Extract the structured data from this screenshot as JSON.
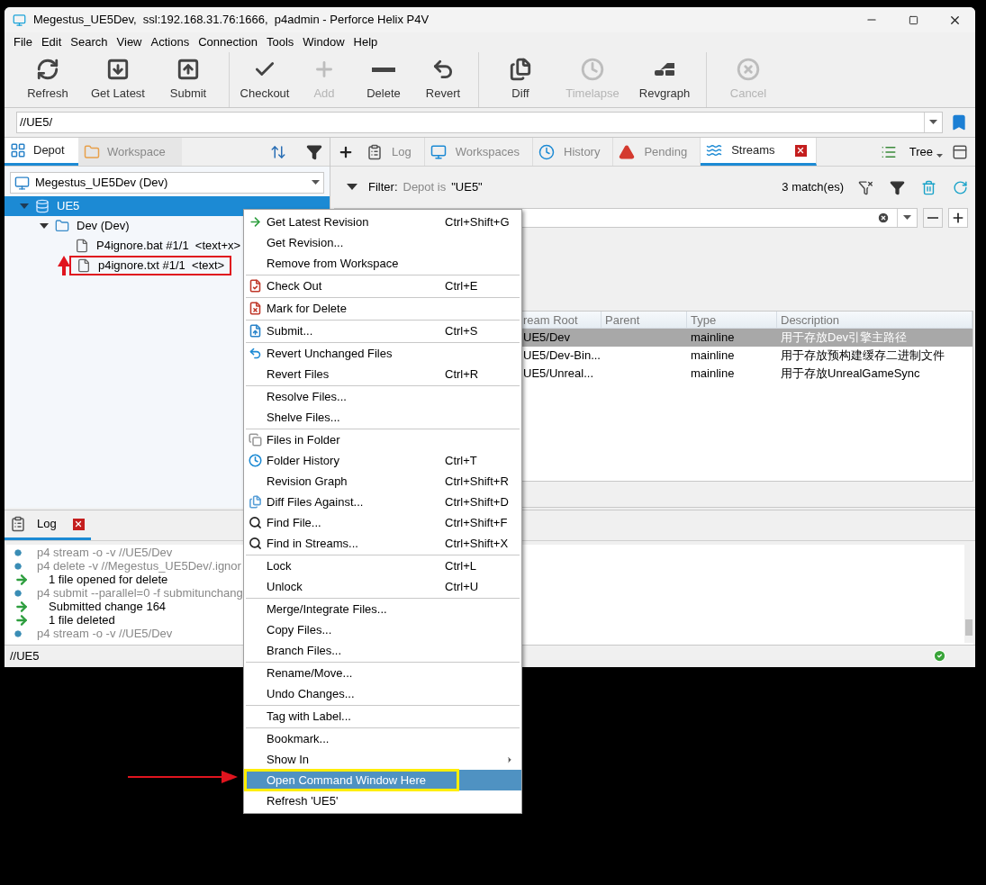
{
  "window": {
    "title": "Megestus_UE5Dev,  ssl:192.168.31.76:1666,  p4admin - Perforce Helix P4V"
  },
  "menubar": [
    {
      "label": "File"
    },
    {
      "label": "Edit"
    },
    {
      "label": "Search"
    },
    {
      "label": "View"
    },
    {
      "label": "Actions"
    },
    {
      "label": "Connection"
    },
    {
      "label": "Tools"
    },
    {
      "label": "Window"
    },
    {
      "label": "Help"
    }
  ],
  "toolbar": [
    [
      {
        "label": "Refresh",
        "disabled": false
      },
      {
        "label": "Get Latest",
        "disabled": false
      },
      {
        "label": "Submit",
        "disabled": false
      }
    ],
    [
      {
        "label": "Checkout",
        "disabled": false
      },
      {
        "label": "Add",
        "disabled": true
      },
      {
        "label": "Delete",
        "disabled": false
      },
      {
        "label": "Revert",
        "disabled": false
      }
    ],
    [
      {
        "label": "Diff",
        "disabled": false
      },
      {
        "label": "Timelapse",
        "disabled": true
      },
      {
        "label": "Revgraph",
        "disabled": false
      }
    ],
    [
      {
        "label": "Cancel",
        "disabled": true
      }
    ]
  ],
  "path_field": {
    "value": "//UE5/"
  },
  "left_panel": {
    "tabs": [
      {
        "label": "Depot",
        "selected": true
      },
      {
        "label": "Workspace",
        "selected": false
      }
    ],
    "workspace_select": {
      "value": "Megestus_UE5Dev (Dev)"
    },
    "tree": [
      {
        "label": "UE5",
        "selected": true,
        "expanded": true,
        "marked": false,
        "children": [
          {
            "label": "Dev (Dev)",
            "selected": false,
            "expanded": true,
            "marked": false,
            "children": [
              {
                "label": "P4ignore.bat #1/1  <text+x>",
                "selected": false,
                "marked": false
              },
              {
                "label": "p4ignore.txt #1/1  <text>",
                "selected": false,
                "marked": true
              }
            ]
          }
        ]
      }
    ]
  },
  "right_panel": {
    "tabs": [
      {
        "label": "Log",
        "selected": false,
        "closable": false
      },
      {
        "label": "Workspaces",
        "selected": false,
        "closable": false
      },
      {
        "label": "History",
        "selected": false,
        "closable": false
      },
      {
        "label": "Pending",
        "selected": false,
        "closable": false
      },
      {
        "label": "Streams",
        "selected": true,
        "closable": true
      }
    ],
    "view_mode": "Tree",
    "filter": {
      "label": "Filter:",
      "field": "Depot is",
      "value": "\"UE5\"",
      "matches": "3 match(es)"
    },
    "table": {
      "columns": [
        "ream Root",
        "Parent",
        "Type",
        "Description"
      ],
      "rows": [
        {
          "cells": [
            "UE5/Dev",
            "",
            "mainline",
            "用于存放Dev引擎主路径"
          ],
          "selected": true
        },
        {
          "cells": [
            "UE5/Dev-Bin...",
            "",
            "mainline",
            "用于存放预构建缓存二进制文件"
          ],
          "selected": false
        },
        {
          "cells": [
            "UE5/Unreal...",
            "",
            "mainline",
            "用于存放UnrealGameSync"
          ],
          "selected": false
        }
      ]
    }
  },
  "log_panel": {
    "tab": "Log",
    "lines": [
      {
        "kind": "command",
        "text": "p4 stream -o -v //UE5/Dev"
      },
      {
        "kind": "command",
        "text": "p4 delete -v //Megestus_UE5Dev/.ignor"
      },
      {
        "kind": "result",
        "text": "1 file opened for delete"
      },
      {
        "kind": "command",
        "text": "p4 submit --parallel=0 -f submitunchang"
      },
      {
        "kind": "result",
        "text": "Submitted change 164"
      },
      {
        "kind": "result",
        "text": "1 file deleted"
      },
      {
        "kind": "command",
        "text": "p4 stream -o -v //UE5/Dev"
      }
    ]
  },
  "status_bar": {
    "path": "//UE5"
  },
  "context_menu": [
    [
      {
        "label": "Get Latest Revision",
        "shortcut": "Ctrl+Shift+G",
        "selected": false
      },
      {
        "label": "Get Revision...",
        "selected": false
      },
      {
        "label": "Remove from Workspace",
        "selected": false
      }
    ],
    [
      {
        "label": "Check Out",
        "shortcut": "Ctrl+E",
        "selected": false
      }
    ],
    [
      {
        "label": "Mark for Delete",
        "selected": false
      }
    ],
    [
      {
        "label": "Submit...",
        "shortcut": "Ctrl+S",
        "selected": false
      }
    ],
    [
      {
        "label": "Revert Unchanged Files",
        "selected": false
      },
      {
        "label": "Revert Files",
        "shortcut": "Ctrl+R",
        "selected": false
      }
    ],
    [
      {
        "label": "Resolve Files...",
        "selected": false
      },
      {
        "label": "Shelve Files...",
        "selected": false
      }
    ],
    [
      {
        "label": "Files in Folder",
        "selected": false
      },
      {
        "label": "Folder History",
        "shortcut": "Ctrl+T",
        "selected": false
      },
      {
        "label": "Revision Graph",
        "shortcut": "Ctrl+Shift+R",
        "selected": false
      },
      {
        "label": "Diff Files Against...",
        "shortcut": "Ctrl+Shift+D",
        "selected": false
      },
      {
        "label": "Find File...",
        "shortcut": "Ctrl+Shift+F",
        "selected": false
      },
      {
        "label": "Find in Streams...",
        "shortcut": "Ctrl+Shift+X",
        "selected": false
      }
    ],
    [
      {
        "label": "Lock",
        "shortcut": "Ctrl+L",
        "selected": false
      },
      {
        "label": "Unlock",
        "shortcut": "Ctrl+U",
        "selected": false
      }
    ],
    [
      {
        "label": "Merge/Integrate Files...",
        "selected": false
      },
      {
        "label": "Copy Files...",
        "selected": false
      },
      {
        "label": "Branch Files...",
        "selected": false
      }
    ],
    [
      {
        "label": "Rename/Move...",
        "selected": false
      },
      {
        "label": "Undo Changes...",
        "selected": false
      }
    ],
    [
      {
        "label": "Tag with Label...",
        "selected": false
      }
    ],
    [
      {
        "label": "Bookmark...",
        "selected": false
      },
      {
        "label": "Show In",
        "submenu": true,
        "selected": false
      },
      {
        "label": "Open Command Window Here",
        "selected": true,
        "marked": true
      },
      {
        "label": "Refresh 'UE5'",
        "selected": false
      }
    ]
  ]
}
